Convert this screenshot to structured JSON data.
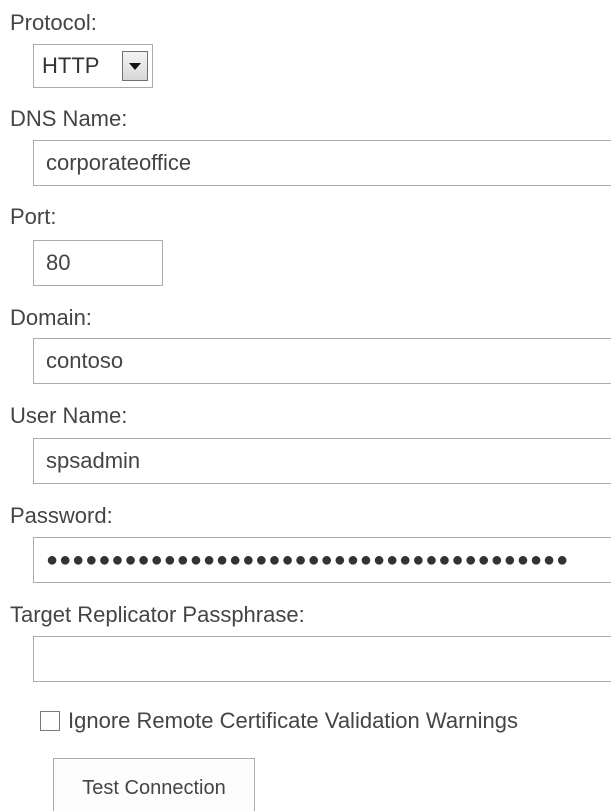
{
  "form": {
    "protocol": {
      "label": "Protocol:",
      "value": "HTTP"
    },
    "dns_name": {
      "label": "DNS Name:",
      "value": "corporateoffice"
    },
    "port": {
      "label": "Port:",
      "value": "80"
    },
    "domain": {
      "label": "Domain:",
      "value": "contoso"
    },
    "user_name": {
      "label": "User Name:",
      "value": "spsadmin"
    },
    "password": {
      "label": "Password:",
      "masked_value": "●●●●●●●●●●●●●●●●●●●●●●●●●●●●●●●●●●●●●●●●"
    },
    "passphrase": {
      "label": "Target Replicator Passphrase:",
      "value": ""
    },
    "ignore_warnings": {
      "label": "Ignore Remote Certificate Validation Warnings",
      "checked": false
    },
    "test_button": {
      "label": "Test Connection"
    }
  }
}
